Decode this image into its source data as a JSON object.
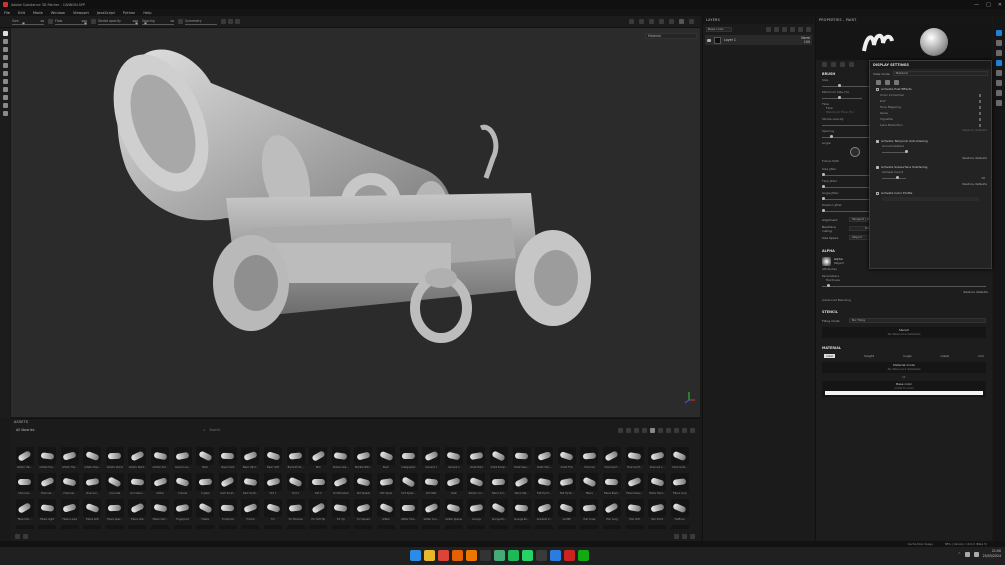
{
  "window": {
    "title": "Adobe Substance 3D Painter - CANNON.SPP",
    "controls": [
      "—",
      "□",
      "✕"
    ]
  },
  "menu": [
    "File",
    "Edit",
    "Mode",
    "Window",
    "Viewport",
    "JavaScript",
    "Python",
    "Help"
  ],
  "toolbar": {
    "size_label": "Size",
    "size_value": "10",
    "flow_label": "Flow",
    "flow_value": "100",
    "opacity_label": "Stroke opacity",
    "opacity_value": "100",
    "spacing_label": "Spacing",
    "spacing_value": "10",
    "symmetry_label": "Symmetry"
  },
  "viewport": {
    "mode": "Material"
  },
  "layers": {
    "title": "LAYERS",
    "base_color": "Base color",
    "layer_name": "Layer 1",
    "blend": "Norm",
    "opacity": "100"
  },
  "properties": {
    "title": "PROPERTIES - PAINT",
    "brush": "BRUSH",
    "size": "Size",
    "min_size": "Minimum Size (%)",
    "flow": "Flow",
    "min_flow": "Minimum Flow (%)",
    "stroke_opacity": "Stroke opacity",
    "spacing": "Spacing",
    "angle": "Angle",
    "follow_path": "Follow Path",
    "size_jitter": "Size Jitter",
    "flow_jitter": "Flow Jitter",
    "angle_jitter": "Angle Jitter",
    "position_jitter": "Position Jitter",
    "alignment_label": "Alignment",
    "alignment_value": "Tangent | Wrap",
    "backface_label": "Backface culling",
    "backface_value": "On",
    "size_space_label": "Size Space",
    "size_space_value": "Object",
    "alpha": "ALPHA",
    "alpha_name": "Alpha",
    "alpha_sub": "Object",
    "attributes": "Attributes",
    "parameters": "Parameters",
    "hardness": "Hardness",
    "restore": "Restore defaults",
    "advanced": "Advanced Blending",
    "stencil": "STENCIL",
    "tiling_label": "Tiling mode",
    "tiling_value": "No Tiling",
    "stencil_btn": "Stencil",
    "no_resource": "No Resource Selected",
    "material": "MATERIAL",
    "channels": [
      "color",
      "height",
      "rough",
      "metal",
      "nrm"
    ],
    "material_mode": "Material mode",
    "or": "Or",
    "base_color": "Base color",
    "uniform_color": "uniform color"
  },
  "display": {
    "title": "DISPLAY SETTINGS",
    "view_mode_label": "View mode",
    "view_mode_value": "Material",
    "post_effects": "Activate Post Effects",
    "sub_effects": [
      "Color Correction",
      "DoF",
      "Tone Mapping",
      "Glare",
      "Vignette",
      "Lens Distortion"
    ],
    "restore_defaults": "Restore defaults",
    "temporal": "Activate Temporal Anti-Aliasing",
    "accumulations": "Accumulations",
    "subsurface": "Activate Subsurface Scattering",
    "sample_count": "Sample Count",
    "sample_value": "16",
    "color_profile": "Activate Color Profile"
  },
  "assets": {
    "title": "ASSETS",
    "library": "All libraries",
    "search": "Search",
    "names": [
      "Artistic Hai...",
      "Artistic Hai...",
      "Artistic Hai...",
      "Artistic Hea...",
      "Artistic Pencil",
      "Artistic Paint...",
      "Artistic Sof...",
      "Autumn Le...",
      "Bark",
      "Basic Hard",
      "Basic Hard...",
      "Basic Soft",
      "Bismuth Sh...",
      "Blot",
      "Broken Gla...",
      "Bubble Stitc...",
      "Bush",
      "Calligraphic",
      "Cement 1",
      "Cement 2",
      "Chalk Bold",
      "Chalk Bump...",
      "Chalk Spre...",
      "Chalk Stro...",
      "Chalk Thin",
      "Charcoal",
      "Charcoal Fi...",
      "Charcoal H...",
      "Charcoal L...",
      "Charcoal N...",
      "Charcoal...",
      "Charcoal...",
      "Charcoal...",
      "Charcoal...",
      "Concrete",
      "Concrete L...",
      "Cotton",
      "Crackle",
      "Crystal",
      "Dark Scrat...",
      "Dark Scrat...",
      "Dirt 1",
      "Dirt 2",
      "Dirt 3",
      "Dirt Brushed",
      "Dirt Splash",
      "Dirt Spots",
      "Dirt Spots...",
      "Dirt Wall",
      "Dust",
      "Electric Lin...",
      "Fabric Cor...",
      "Fabric Pat...",
      "Felt Tip Hi...",
      "Felt Tip M...",
      "Fibers",
      "Fibers Bush...",
      "Fibers Dens...",
      "Fibers Hard...",
      "Fibers Loop",
      "Fibers Mo...",
      "Fibers Light",
      "Fibers Lined",
      "Fibers Soft",
      "Fibers Spar...",
      "Fibers Vein",
      "Fibers Vert...",
      "Fingerprint",
      "Flakes",
      "Footprints",
      "Fractal",
      "Fur",
      "Fur Brushes",
      "Fur Soft Tip",
      "Fur Tip",
      "Fur Spread",
      "Glitter",
      "Glitter Cha...",
      "Glitter Con...",
      "Glitter Sparse",
      "Grunge",
      "Grunge Br...",
      "Grunge Ro...",
      "Gradient V...",
      "Graffiti",
      "Hair Lines",
      "Hair Long",
      "Hair Soft",
      "Hair Short",
      "Halftone",
      "Heart",
      "Honeycomb",
      "Hex",
      "Ink",
      "Ink Drips",
      "Ink Splat",
      "Ink Wet",
      "Knit",
      "Leaves",
      "Lines",
      "Marker",
      "Moss",
      "Noise",
      "Oil",
      "Paint",
      "Paper",
      "Pebbles",
      "Pencil",
      "Plaster",
      "Rock",
      "Rust",
      "Sand",
      "Scratches",
      "Smoke",
      "Splatter",
      "Spray",
      "Stars",
      "Stone",
      "Water",
      "Wood"
    ]
  },
  "statusbar": {
    "disk": "Cache Disk Usage",
    "version": "88% | Version: 10.0.0 (Beta 5)"
  },
  "taskbar": {
    "time": "21:00",
    "date": "25/03/2024"
  }
}
